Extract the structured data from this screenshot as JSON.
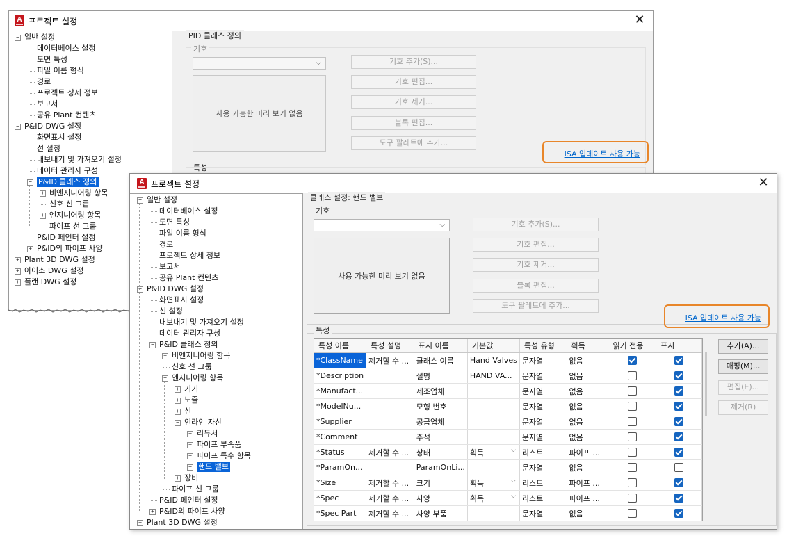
{
  "back_window": {
    "title": "프로젝트 설정",
    "tree": [
      {
        "label": "일반 설정",
        "pm": "-"
      },
      {
        "label": "데이터베이스 설정"
      },
      {
        "label": "도면 특성"
      },
      {
        "label": "파일 이름 형식"
      },
      {
        "label": "경로"
      },
      {
        "label": "프로젝트 상세 정보"
      },
      {
        "label": "보고서"
      },
      {
        "label": "공유 Plant 컨텐츠"
      },
      {
        "label": "P&ID DWG 설정",
        "pm": "-"
      },
      {
        "label": "화면표시 설정"
      },
      {
        "label": "선 설정"
      },
      {
        "label": "내보내기 및 가져오기 설정"
      },
      {
        "label": "데이터 관리자 구성"
      },
      {
        "label": "P&ID 클래스 정의",
        "pm": "-",
        "selected": true
      },
      {
        "label": "비엔지니어링 항목",
        "pm": "+"
      },
      {
        "label": "신호 선 그룹"
      },
      {
        "label": "엔지니어링 항목",
        "pm": "+"
      },
      {
        "label": "파이프 선 그룹"
      },
      {
        "label": "P&ID 페인터 설정"
      },
      {
        "label": "P&ID의 파이프 사양",
        "pm": "+"
      },
      {
        "label": "Plant 3D DWG 설정",
        "pm": "+"
      },
      {
        "label": "아이소 DWG 설정",
        "pm": "+"
      },
      {
        "label": "플랜 DWG 설정",
        "pm": "+"
      }
    ],
    "panel_title": "PID 클래스 정의",
    "symbol_group": "기호",
    "preview_text": "사용 가능한 미리 보기 없음",
    "buttons": [
      "기호 추가(S)...",
      "기호 편집...",
      "기호 제거...",
      "블록 편집...",
      "도구 팔레트에 추가..."
    ],
    "isa_link": "ISA 업데이트 사용 가능",
    "properties_group": "특성"
  },
  "front_window": {
    "title": "프로젝트 설정",
    "tree": [
      {
        "label": "일반 설정",
        "pm": "-"
      },
      {
        "label": "데이터베이스 설정"
      },
      {
        "label": "도면 특성"
      },
      {
        "label": "파일 이름 형식"
      },
      {
        "label": "경로"
      },
      {
        "label": "프로젝트 상세 정보"
      },
      {
        "label": "보고서"
      },
      {
        "label": "공유 Plant 컨텐츠"
      },
      {
        "label": "P&ID DWG 설정",
        "pm": "-"
      },
      {
        "label": "화면표시 설정"
      },
      {
        "label": "선 설정"
      },
      {
        "label": "내보내기 및 가져오기 설정"
      },
      {
        "label": "데이터 관리자 구성"
      },
      {
        "label": "P&ID 클래스 정의",
        "pm": "-"
      },
      {
        "label": "비엔지니어링 항목",
        "pm": "+"
      },
      {
        "label": "신호 선 그룹"
      },
      {
        "label": "엔지니어링 항목",
        "pm": "-"
      },
      {
        "label": "기기",
        "pm": "+"
      },
      {
        "label": "노즐",
        "pm": "+"
      },
      {
        "label": "선",
        "pm": "+"
      },
      {
        "label": "인라인 자산",
        "pm": "-"
      },
      {
        "label": "리듀서",
        "pm": "+"
      },
      {
        "label": "파이프 부속품",
        "pm": "+"
      },
      {
        "label": "파이프 특수 항목",
        "pm": "+"
      },
      {
        "label": "핸드 밸브",
        "pm": "+",
        "selected": true
      },
      {
        "label": "장비",
        "pm": "+"
      },
      {
        "label": "파이프 선 그룹"
      },
      {
        "label": "P&ID 페인터 설정"
      },
      {
        "label": "P&ID의 파이프 사양",
        "pm": "+"
      },
      {
        "label": "Plant 3D DWG 설정",
        "pm": "+"
      }
    ],
    "panel_title": "클래스 설정: 핸드 밸브",
    "symbol_group": "기호",
    "preview_text": "사용 가능한 미리 보기 없음",
    "buttons": [
      "기호 추가(S)...",
      "기호 편집...",
      "기호 제거...",
      "블록 편집...",
      "도구 팔레트에 추가..."
    ],
    "isa_link": "ISA 업데이트 사용 가능",
    "properties_group": "특성",
    "grid": {
      "columns": [
        "특성 이름",
        "특성 설명",
        "표시 이름",
        "기본값",
        "특성 유형",
        "획득",
        "읽기 전용",
        "표시"
      ],
      "rows": [
        {
          "name": "*ClassName",
          "desc": "제거할 수 ...",
          "display": "클래스 이름",
          "default": "Hand Valves",
          "type": "문자열",
          "acquire": "없음",
          "readonly": true,
          "visible": true,
          "selected": true
        },
        {
          "name": "*Description",
          "desc": "",
          "display": "설명",
          "default": "HAND VA...",
          "type": "문자열",
          "acquire": "없음",
          "readonly": false,
          "visible": true
        },
        {
          "name": "*Manufact...",
          "desc": "",
          "display": "제조업체",
          "default": "",
          "type": "문자열",
          "acquire": "없음",
          "readonly": false,
          "visible": true
        },
        {
          "name": "*ModelNu...",
          "desc": "",
          "display": "모형 번호",
          "default": "",
          "type": "문자열",
          "acquire": "없음",
          "readonly": false,
          "visible": true
        },
        {
          "name": "*Supplier",
          "desc": "",
          "display": "공급업체",
          "default": "",
          "type": "문자열",
          "acquire": "없음",
          "readonly": false,
          "visible": true
        },
        {
          "name": "*Comment",
          "desc": "",
          "display": "주석",
          "default": "",
          "type": "문자열",
          "acquire": "없음",
          "readonly": false,
          "visible": true
        },
        {
          "name": "*Status",
          "desc": "제거할 수 ...",
          "display": "상태",
          "default": "획득",
          "dd": true,
          "type": "리스트",
          "acquire": "파이프 ...",
          "readonly": false,
          "visible": true
        },
        {
          "name": "*ParamOn...",
          "desc": "",
          "display": "ParamOnLi...",
          "default": "",
          "type": "문자열",
          "acquire": "없음",
          "readonly": false,
          "visible": false
        },
        {
          "name": "*Size",
          "desc": "제거할 수 ...",
          "display": "크기",
          "default": "획득",
          "dd": true,
          "type": "리스트",
          "acquire": "파이프 ...",
          "readonly": false,
          "visible": true
        },
        {
          "name": "*Spec",
          "desc": "제거할 수 ...",
          "display": "사양",
          "default": "획득",
          "dd": true,
          "type": "리스트",
          "acquire": "파이프 ...",
          "readonly": false,
          "visible": true
        },
        {
          "name": "*Spec Part",
          "desc": "제거할 수 ...",
          "display": "사양 부품",
          "default": "",
          "type": "문자열",
          "acquire": "없음",
          "readonly": false,
          "visible": true
        }
      ]
    },
    "side_buttons": [
      {
        "label": "추가(A)...",
        "enabled": true
      },
      {
        "label": "매핑(M)...",
        "enabled": true
      },
      {
        "label": "편집(E)...",
        "enabled": false
      },
      {
        "label": "제거(R)",
        "enabled": false
      }
    ]
  }
}
